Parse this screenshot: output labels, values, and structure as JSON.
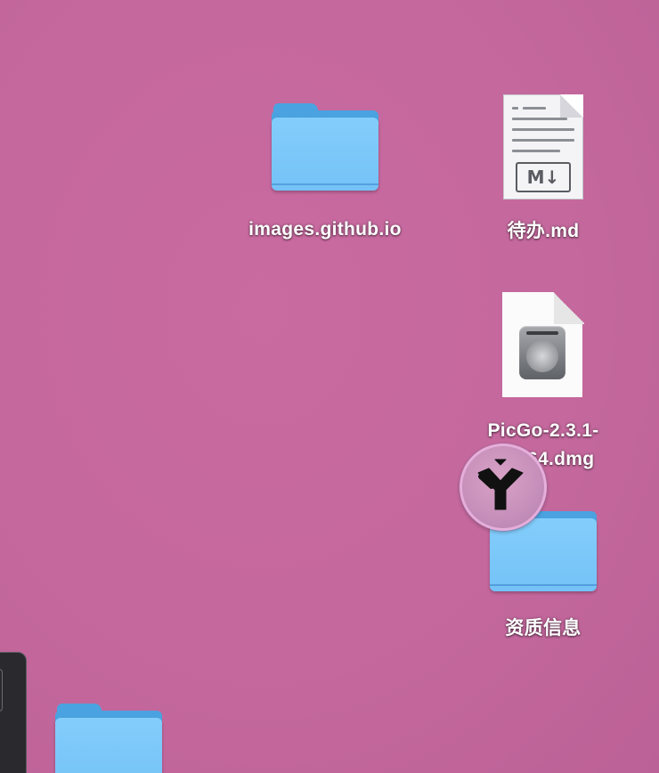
{
  "desktop": {
    "items": [
      {
        "label": "images.github.io",
        "icon": "folder-icon"
      },
      {
        "label": "待办.md",
        "icon": "markdown-file-icon",
        "badge": "M↓",
        "header_mark": "#"
      },
      {
        "label_line1": "PicGo-2.3.1-",
        "label_line2": "arm64.dmg",
        "icon": "disk-image-icon"
      },
      {
        "label": "资质信息",
        "icon": "folder-icon"
      },
      {
        "label": "",
        "icon": "folder-icon"
      }
    ],
    "floating_badge_icon": "app-logo-icon",
    "colors": {
      "wallpaper": "#c4689d",
      "folder_front": "#7cc8f9",
      "folder_back": "#4aa3e0"
    }
  }
}
